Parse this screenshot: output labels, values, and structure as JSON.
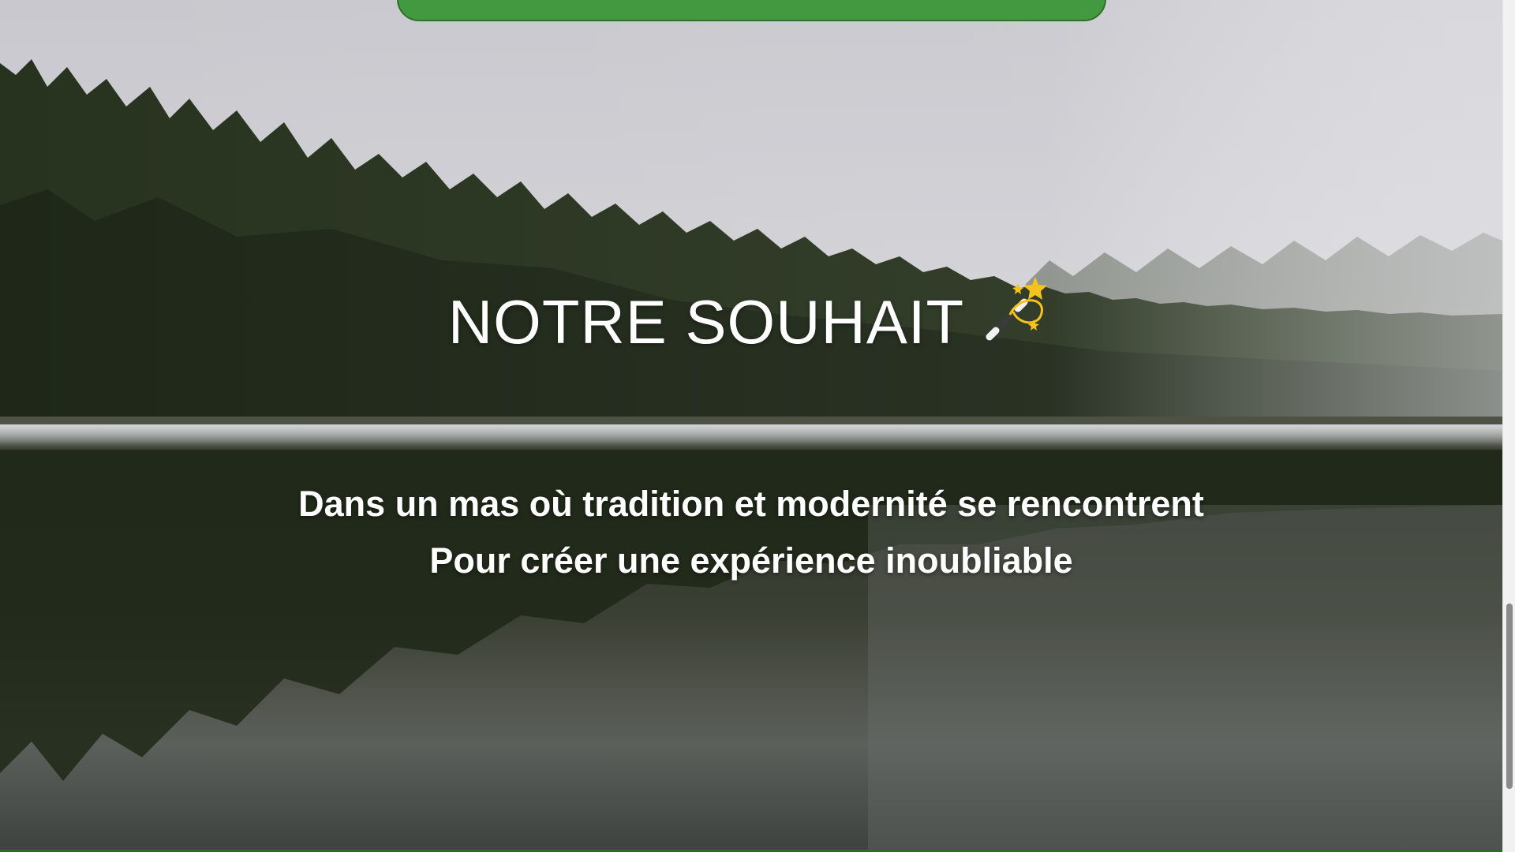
{
  "hero": {
    "title": "NOTRE SOUHAIT",
    "title_emoji_icon": "magic-wand-icon",
    "subtitle_lines": [
      "Dans un mas où tradition et modernité se rencontrent",
      "Pour créer une expérience inoubliable"
    ]
  },
  "colors": {
    "banner": "#43993f",
    "text": "#ffffff",
    "sky": "#cfd0d5",
    "forest": "#26311f",
    "water": "#3e423c"
  }
}
